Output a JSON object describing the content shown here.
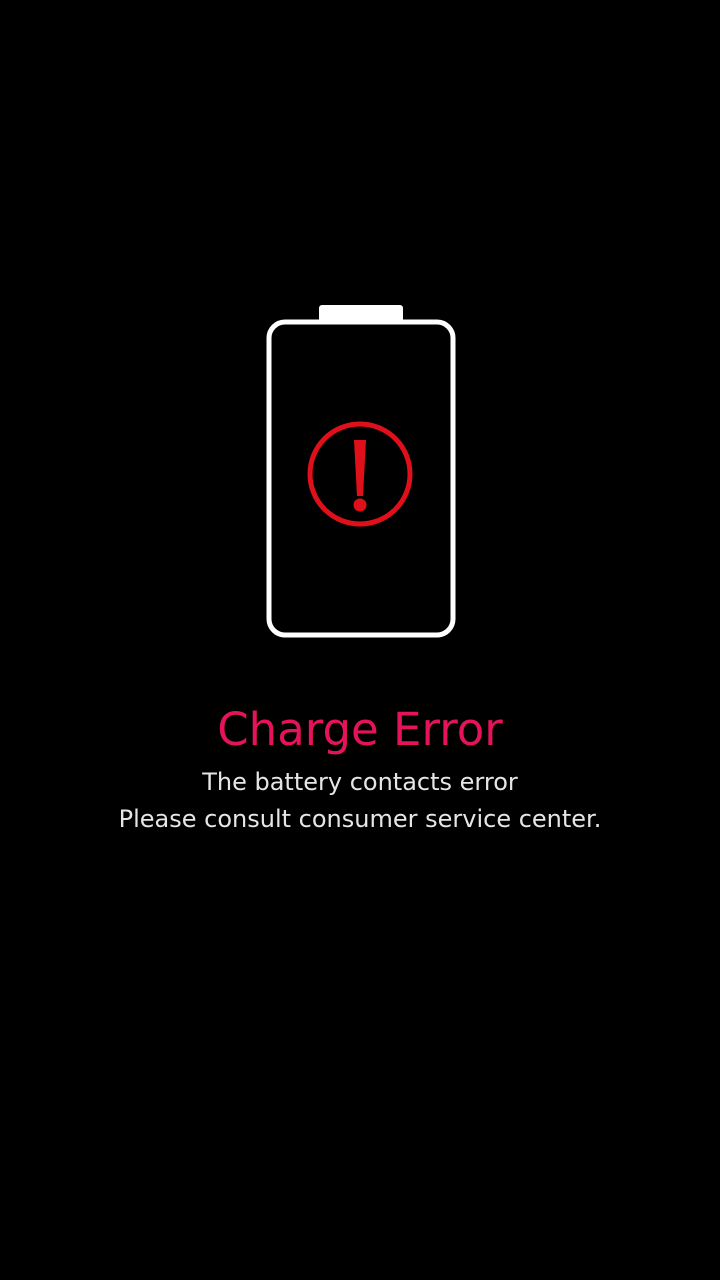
{
  "colors": {
    "background": "#000000",
    "title": "#e4135a",
    "message": "#e6e6e6",
    "battery_outline": "#ffffff",
    "alert": "#e0101a"
  },
  "icons": {
    "battery": "battery-outline-icon",
    "alert": "exclamation-circle-icon"
  },
  "error": {
    "title": "Charge Error",
    "line1": "The battery contacts error",
    "line2": "Please consult consumer service center."
  }
}
